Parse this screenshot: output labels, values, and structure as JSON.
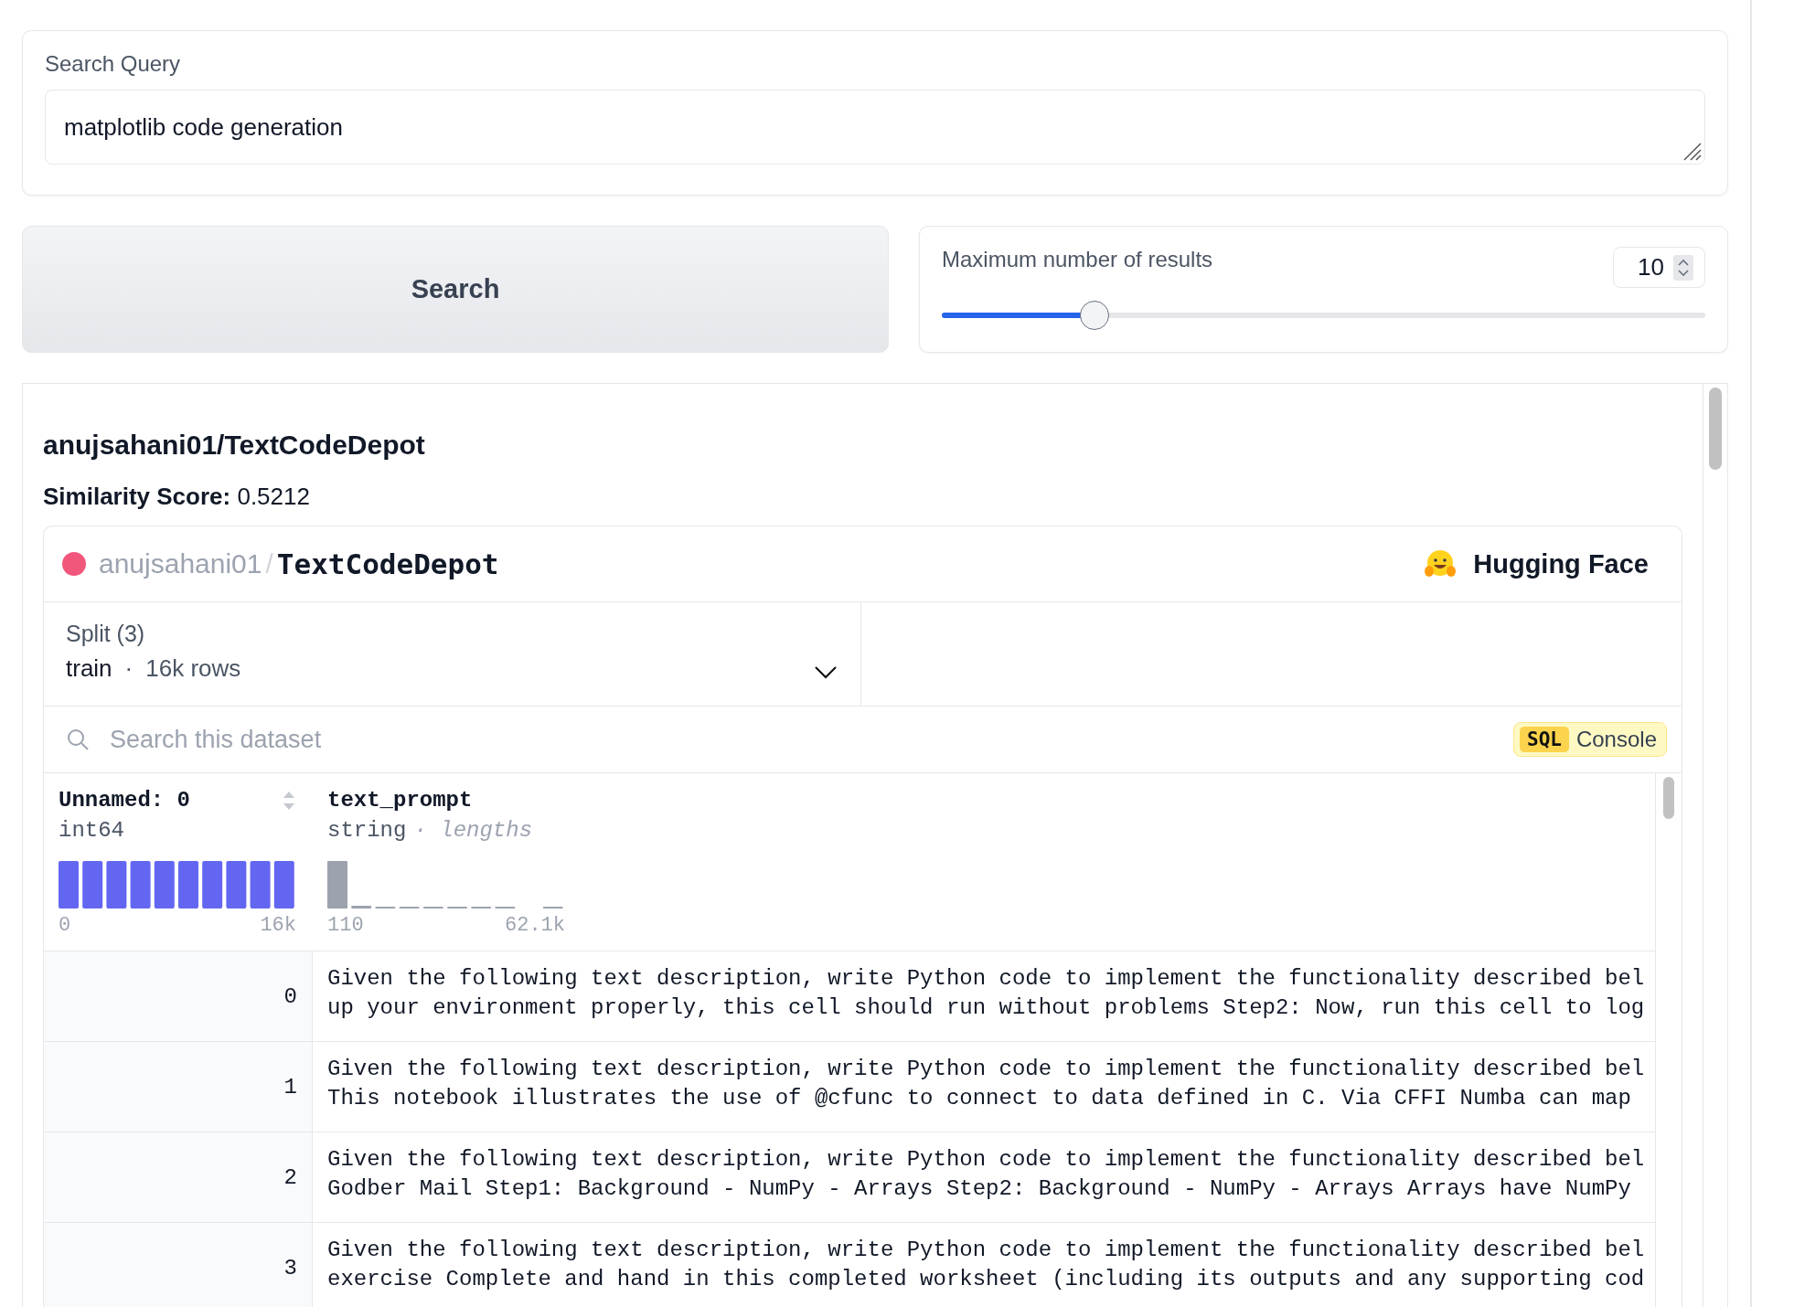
{
  "search_query": {
    "label": "Search Query",
    "value": "matplotlib code generation"
  },
  "search_button": {
    "label": "Search"
  },
  "max_results": {
    "label": "Maximum number of results",
    "value": "10",
    "level": 0.2
  },
  "result": {
    "title": "anujsahani01/TextCodeDepot",
    "score": "**Similarity Score:** 0.5212",
    "viewer": {
      "owner": "anujsahani01",
      "separator": "/",
      "name": "TextCodeDepot",
      "brand": "Hugging Face",
      "split": {
        "label": "Split (3)",
        "value": "train",
        "dot": "·",
        "rows": "16k rows"
      },
      "search_placeholder": "Search this dataset",
      "sql_badge": "SQL",
      "console": "Console",
      "columns": [
        {
          "kind": "numeric",
          "name": "Unnamed: 0",
          "type": "int64",
          "min": "0",
          "max": "16k"
        },
        {
          "kind": "text",
          "name": "text_prompt",
          "type": "string",
          "extra": "· lengths",
          "min": "110",
          "max": "62.1k"
        }
      ],
      "rows": [
        {
          "index": "0",
          "lines": [
            "Given the following text description, write Python code to implement the functionality described bel",
            "up your environment properly, this cell should run without problems Step2: Now, run this cell to log"
          ]
        },
        {
          "index": "1",
          "lines": [
            "Given the following text description, write Python code to implement the functionality described bel",
            "This notebook illustrates the use of @cfunc to connect to data defined in C. Via CFFI Numba can map"
          ]
        },
        {
          "index": "2",
          "lines": [
            "Given the following text description, write Python code to implement the functionality described bel",
            "Godber Mail Step1: Background - NumPy - Arrays Step2: Background - NumPy - Arrays Arrays have NumPy"
          ]
        },
        {
          "index": "3",
          "lines": [
            "Given the following text description, write Python code to implement the functionality described bel",
            "exercise Complete and hand in this completed worksheet (including its outputs and any supporting cod"
          ]
        }
      ]
    }
  }
}
